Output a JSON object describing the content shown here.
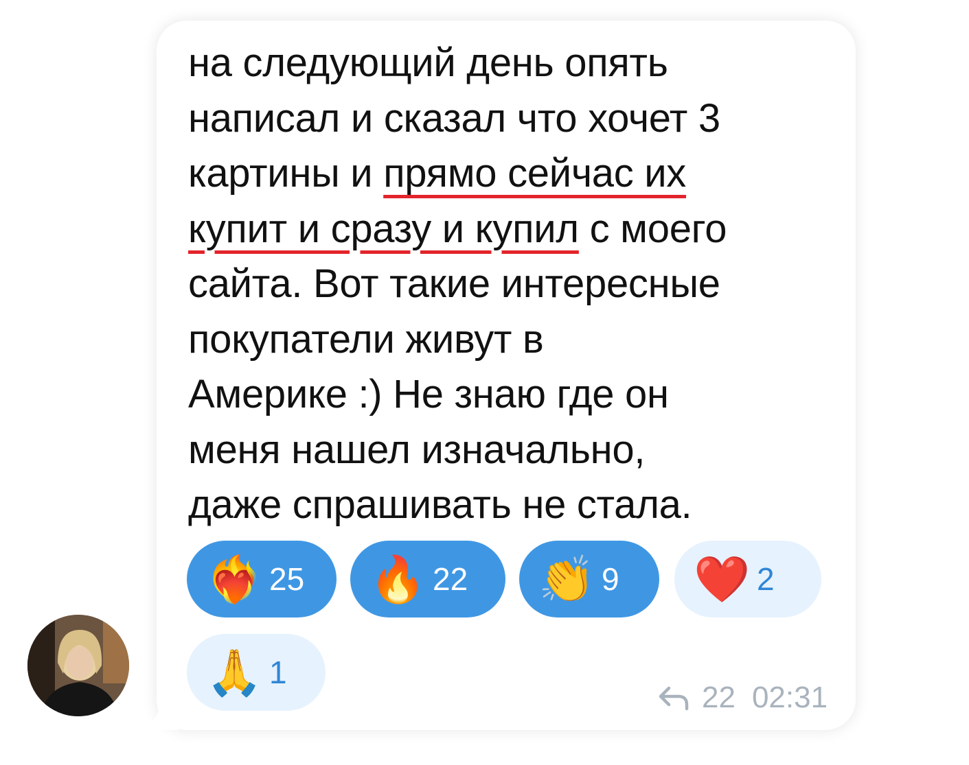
{
  "message": {
    "lines": [
      "на следующий день опять",
      "написал и сказал что хочет 3",
      "картины и ",
      "прямо сейчас их",
      "купит и сразу и купил",
      " с моего",
      "сайта. Вот такие интересные",
      "покупатели живут в",
      "Америке :) Не знаю где он",
      "меня нашел изначально,",
      "даже спрашивать не стала."
    ],
    "underline_color": "#e3242b"
  },
  "reactions": [
    {
      "icon": "heart-on-fire-icon",
      "emoji": "❤️‍🔥",
      "count": "25",
      "active": true
    },
    {
      "icon": "fire-icon",
      "emoji": "🔥",
      "count": "22",
      "active": true
    },
    {
      "icon": "clapping-hands-icon",
      "emoji": "👏",
      "count": "9",
      "active": true
    },
    {
      "icon": "red-heart-icon",
      "emoji": "❤️",
      "count": "2",
      "active": false
    },
    {
      "icon": "folded-hands-icon",
      "emoji": "🙏",
      "count": "1",
      "active": false
    }
  ],
  "meta": {
    "replies": "22",
    "time": "02:31"
  },
  "colors": {
    "reaction_active": "#3f97e4",
    "reaction_inactive": "#e6f2fd",
    "reaction_inactive_text": "#2f86d6",
    "meta_text": "#a9b3bd"
  }
}
